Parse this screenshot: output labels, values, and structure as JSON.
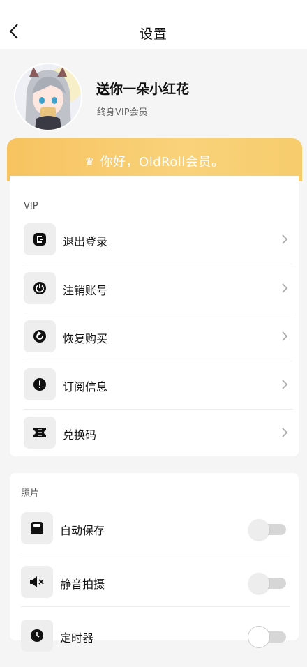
{
  "header": {
    "title": "设置"
  },
  "profile": {
    "name": "送你一朵小红花",
    "subtitle": "终身VIP会员"
  },
  "vip_banner": {
    "text": "你好，OldRoll会员。"
  },
  "vip_section": {
    "title": "VIP",
    "items": [
      {
        "label": "退出登录",
        "icon": "logout-icon"
      },
      {
        "label": "注销账号",
        "icon": "power-icon"
      },
      {
        "label": "恢复购买",
        "icon": "restore-icon"
      },
      {
        "label": "订阅信息",
        "icon": "info-icon"
      },
      {
        "label": "兑换码",
        "icon": "ticket-icon"
      }
    ]
  },
  "photo_section": {
    "title": "照片",
    "items": [
      {
        "label": "自动保存",
        "icon": "save-icon",
        "enabled": false
      },
      {
        "label": "静音拍摄",
        "icon": "mute-icon",
        "enabled": false
      },
      {
        "label": "定时器",
        "icon": "timer-icon",
        "enabled": false
      }
    ]
  },
  "colors": {
    "banner_start": "#f7c360",
    "banner_end": "#f9d27a",
    "icon_bg": "#eeeeee"
  }
}
